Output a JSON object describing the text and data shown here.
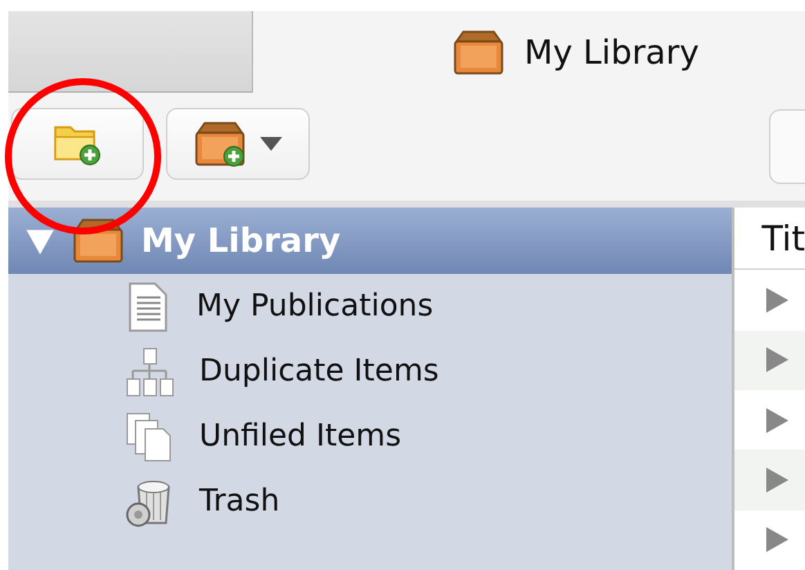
{
  "title_bar": {
    "title": "My Library"
  },
  "toolbar": {
    "buttons": [
      {
        "kind": "new-collection",
        "dropdown": false
      },
      {
        "kind": "new-library",
        "dropdown": true
      }
    ]
  },
  "collections": {
    "library": {
      "label": "My Library",
      "expanded": true,
      "selected": true,
      "children": [
        {
          "label": "My Publications",
          "kind": "publications",
          "selected": false
        },
        {
          "label": "Duplicate Items",
          "kind": "duplicates",
          "selected": false
        },
        {
          "label": "Unfiled Items",
          "kind": "unfiled",
          "selected": false
        },
        {
          "label": "Trash",
          "kind": "trash",
          "selected": false
        }
      ]
    }
  },
  "items": {
    "columns": [
      "Tit"
    ],
    "rows": [
      {
        "expanded": false
      },
      {
        "expanded": false
      },
      {
        "expanded": false
      },
      {
        "expanded": false
      },
      {
        "expanded": false
      }
    ]
  }
}
